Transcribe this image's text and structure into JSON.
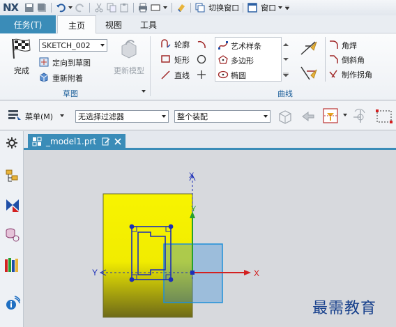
{
  "app": {
    "logo": "NX"
  },
  "quick_access": {
    "switch_window": "切换窗口",
    "window": "窗口"
  },
  "ribbon_tabs": [
    {
      "label": "任务(T)",
      "kind": "file"
    },
    {
      "label": "主页",
      "kind": "active"
    },
    {
      "label": "视图",
      "kind": "normal"
    },
    {
      "label": "工具",
      "kind": "normal"
    }
  ],
  "sketch_group": {
    "label": "草图",
    "finish": "完成",
    "sketch_select": "SKETCH_002",
    "orient_to_sketch": "定向到草图",
    "reattach": "重新附着",
    "update_model": "更新模型"
  },
  "curve_group": {
    "label": "曲线",
    "profile": "轮廓",
    "rectangle": "矩形",
    "line": "直线",
    "studio_spline": "艺术样条",
    "polygon": "多边形",
    "ellipse": "椭圆",
    "fillet": "角焊",
    "chamfer": "倒斜角",
    "make_corner": "制作拐角"
  },
  "command_bar": {
    "menu": "菜单(M)",
    "filter": "无选择过滤器",
    "assembly": "整个装配"
  },
  "document": {
    "tab_label": "_model1.prt"
  },
  "axes": {
    "x": "X",
    "y": "Y"
  },
  "colors": {
    "accent": "#3a8cb8",
    "sketch_line": "#1c2fb8",
    "axis_x": "#d32020",
    "axis_y": "#27a02e",
    "plane_blue": "#1e8fd8"
  },
  "watermark": "最需教育"
}
